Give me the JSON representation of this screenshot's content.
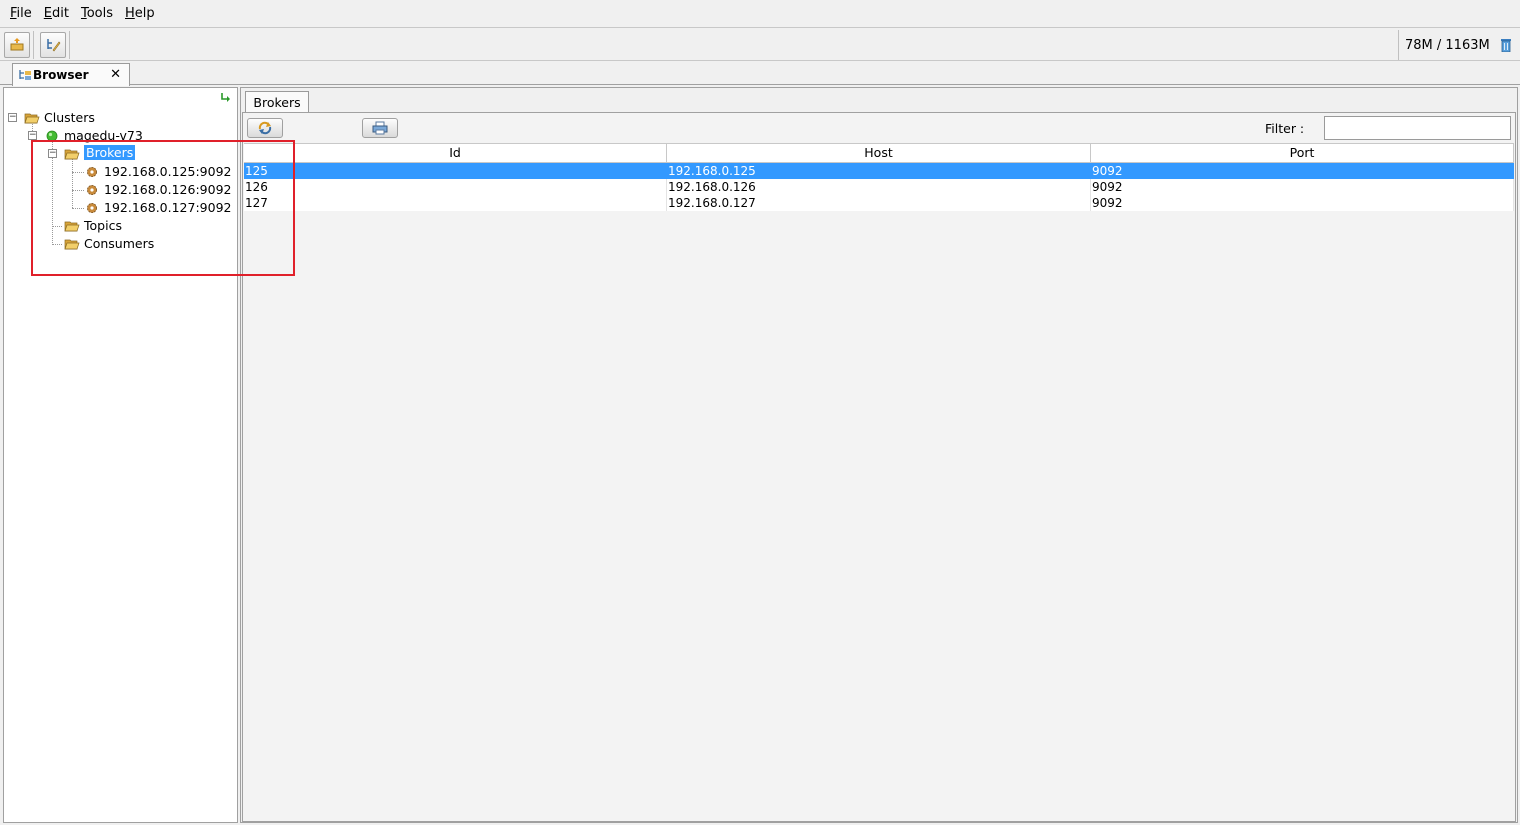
{
  "menu": {
    "file": {
      "key": "F",
      "rest": "ile"
    },
    "edit": {
      "key": "E",
      "rest": "dit"
    },
    "tools": {
      "key": "T",
      "rest": "ools"
    },
    "help": {
      "key": "H",
      "rest": "elp"
    }
  },
  "toolbar": {
    "memory": "78M / 1163M"
  },
  "doc_tab": {
    "label": "Browser",
    "close": "✕"
  },
  "tree": {
    "root": "Clusters",
    "cluster": "magedu-v73",
    "brokers": "Brokers",
    "broker_items": [
      "192.168.0.125:9092",
      "192.168.0.126:9092",
      "192.168.0.127:9092"
    ],
    "topics": "Topics",
    "consumers": "Consumers"
  },
  "brokers_tab": {
    "label": "Brokers",
    "filter_label": "Filter :",
    "filter_value": ""
  },
  "table": {
    "columns": [
      "Id",
      "Host",
      "Port"
    ],
    "rows": [
      {
        "id": "125",
        "host": "192.168.0.125",
        "port": "9092"
      },
      {
        "id": "126",
        "host": "192.168.0.126",
        "port": "9092"
      },
      {
        "id": "127",
        "host": "192.168.0.127",
        "port": "9092"
      }
    ],
    "selected_row": 0
  },
  "colors": {
    "selection": "#3399ff",
    "annotation_box": "#e0202a",
    "cluster_status": "#44bb33",
    "folder": "#e8b84a"
  }
}
